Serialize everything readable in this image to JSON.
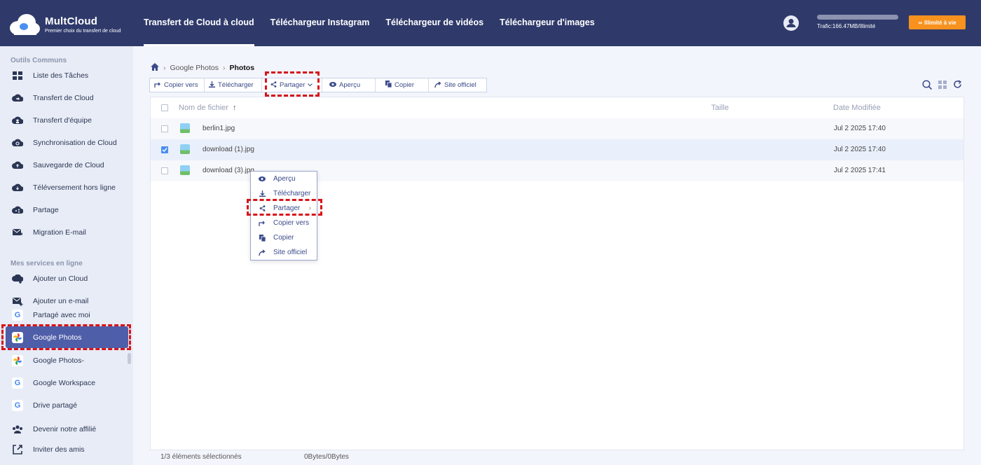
{
  "header": {
    "brand": "MultCloud",
    "tagline": "Premier choix du transfert de cloud",
    "nav": [
      {
        "label": "Transfert de Cloud à cloud",
        "active": true
      },
      {
        "label": "Téléchargeur Instagram",
        "active": false
      },
      {
        "label": "Téléchargeur de vidéos",
        "active": false
      },
      {
        "label": "Téléchargeur d'images",
        "active": false
      }
    ],
    "traffic": "Trafic:166.47MB/Illimité",
    "unlimited_label": "Illimité à vie"
  },
  "sidebar": {
    "section_common": "Outils Communs",
    "common_items": [
      {
        "label": "Liste des Tâches",
        "icon": "task-list-icon"
      },
      {
        "label": "Transfert de Cloud",
        "icon": "cloud-transfer-icon"
      },
      {
        "label": "Transfert d'équipe",
        "icon": "team-transfer-icon"
      },
      {
        "label": "Synchronisation de Cloud",
        "icon": "cloud-sync-icon"
      },
      {
        "label": "Sauvegarde de Cloud",
        "icon": "cloud-backup-icon"
      },
      {
        "label": "Téléversement hors ligne",
        "icon": "offline-upload-icon"
      },
      {
        "label": "Partage",
        "icon": "share-icon"
      },
      {
        "label": "Migration E-mail",
        "icon": "email-migration-icon"
      }
    ],
    "section_online": "Mes services en ligne",
    "online_items": [
      {
        "label": "Ajouter un Cloud",
        "icon": "add-cloud-icon"
      },
      {
        "label": "Ajouter un e-mail",
        "icon": "add-email-icon"
      },
      {
        "label": "Partagé avec moi",
        "icon": "google-icon"
      },
      {
        "label": "Google Photos",
        "icon": "google-photos-icon",
        "active": true
      },
      {
        "label": "Google Photos-",
        "icon": "google-photos-icon"
      },
      {
        "label": "Google Workspace",
        "icon": "google-icon"
      },
      {
        "label": "Drive partagé",
        "icon": "google-icon"
      },
      {
        "label": "Devenir notre affilié",
        "icon": "affiliate-icon"
      },
      {
        "label": "Inviter des amis",
        "icon": "invite-icon"
      }
    ]
  },
  "breadcrumb": {
    "root": "Google Photos",
    "current": "Photos"
  },
  "toolbar": {
    "copy_to": "Copier vers",
    "download": "Télécharger",
    "share": "Partager",
    "preview": "Aperçu",
    "copy": "Copier",
    "official_site": "Site officiel"
  },
  "table": {
    "columns": {
      "name": "Nom de fichier",
      "size": "Taille",
      "modified": "Date Modifiée"
    },
    "rows": [
      {
        "name": "berlin1.jpg",
        "modified": "Jul 2 2025 17:40",
        "checked": false
      },
      {
        "name": "download (1).jpg",
        "modified": "Jul 2 2025 17:40",
        "checked": true
      },
      {
        "name": "download (3).jpg",
        "modified": "Jul 2 2025 17:41",
        "checked": false
      }
    ]
  },
  "context_menu": {
    "items": [
      {
        "label": "Aperçu",
        "icon": "eye-icon"
      },
      {
        "label": "Télécharger",
        "icon": "download-icon"
      },
      {
        "label": "Partager",
        "icon": "share-icon",
        "submenu": true
      },
      {
        "label": "Copier vers",
        "icon": "copy-to-icon"
      },
      {
        "label": "Copier",
        "icon": "copy-icon"
      },
      {
        "label": "Site officiel",
        "icon": "external-link-icon"
      }
    ]
  },
  "status": {
    "selected": "1/3 éléments sélectionnés",
    "size": "0Bytes/0Bytes"
  },
  "colors": {
    "header": "#2f3a6b",
    "accent": "#4f5ea8",
    "orange": "#f7921e",
    "highlight": "#d8141a"
  }
}
